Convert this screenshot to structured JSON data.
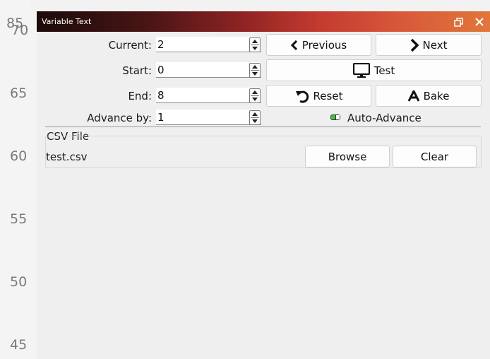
{
  "ruler": {
    "labels": [
      "85",
      "70",
      "65",
      "60",
      "55",
      "50",
      "45"
    ]
  },
  "window": {
    "title": "Variable Text"
  },
  "fields": {
    "current": {
      "label": "Current:",
      "value": "2"
    },
    "start": {
      "label": "Start:",
      "value": "0"
    },
    "end": {
      "label": "End:",
      "value": "8"
    },
    "advance": {
      "label": "Advance by:",
      "value": "1"
    }
  },
  "buttons": {
    "previous": "Previous",
    "next": "Next",
    "test": "Test",
    "reset": "Reset",
    "bake": "Bake"
  },
  "auto_advance": {
    "label": "Auto-Advance",
    "enabled": true,
    "color": "#3cc63c"
  },
  "csv": {
    "group_title": "CSV File",
    "filename": "test.csv",
    "browse": "Browse",
    "clear": "Clear"
  }
}
